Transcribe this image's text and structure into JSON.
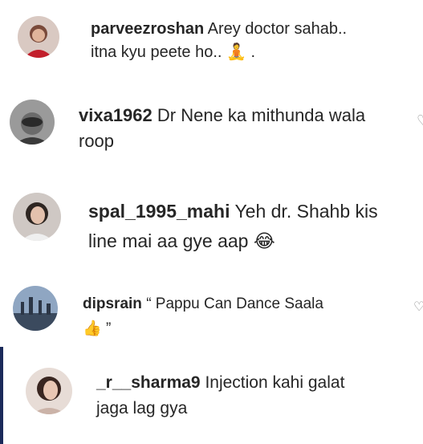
{
  "comments": [
    {
      "username": "parveezroshan",
      "text_1": "Arey doctor sahab..",
      "text_2": "itna kyu peete ho..",
      "emoji": "🧘",
      "tail": " ."
    },
    {
      "username": "vixa1962",
      "text_1": "Dr Nene ka mithunda wala",
      "text_2": "roop"
    },
    {
      "username": "spal_1995_mahi",
      "text_1": "Yeh dr. Shahb kis",
      "text_2": "line mai aa gye aap",
      "emoji": "😂"
    },
    {
      "username": "dipsrain",
      "text_1": "“ Pappu Can Dance Saala",
      "emoji": "👍",
      "tail": " ”"
    },
    {
      "username": "_r__sharma9",
      "text_1": "Injection kahi galat",
      "text_2": "jaga lag gya"
    }
  ],
  "like_icon": "heart-outline-icon"
}
